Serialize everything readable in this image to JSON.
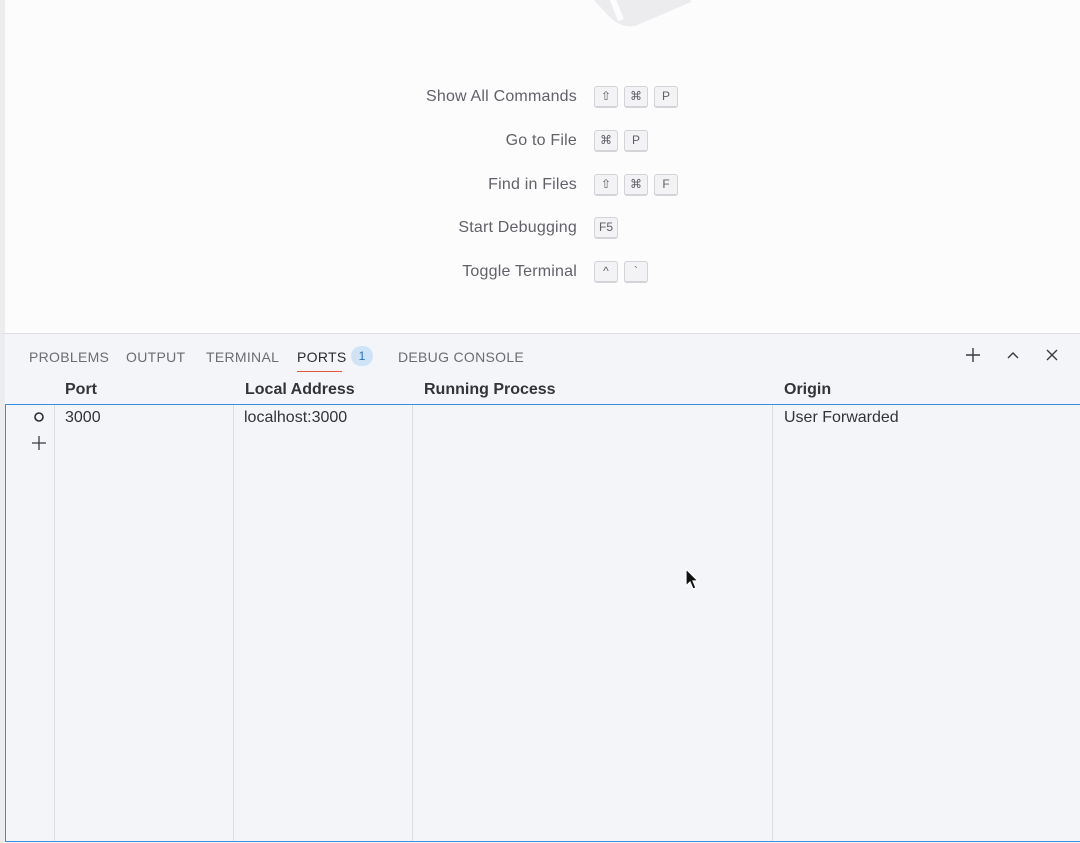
{
  "welcome": {
    "shortcuts": [
      {
        "label": "Show All Commands",
        "keys": [
          "⇧",
          "⌘",
          "P"
        ]
      },
      {
        "label": "Go to File",
        "keys": [
          "⌘",
          "P"
        ]
      },
      {
        "label": "Find in Files",
        "keys": [
          "⇧",
          "⌘",
          "F"
        ]
      },
      {
        "label": "Start Debugging",
        "keys": [
          "F5"
        ]
      },
      {
        "label": "Toggle Terminal",
        "keys": [
          "^",
          "`"
        ]
      }
    ]
  },
  "panel": {
    "tabs": [
      {
        "label": "PROBLEMS",
        "active": false
      },
      {
        "label": "OUTPUT",
        "active": false
      },
      {
        "label": "TERMINAL",
        "active": false
      },
      {
        "label": "PORTS",
        "active": true,
        "badge": "1"
      },
      {
        "label": "DEBUG CONSOLE",
        "active": false
      }
    ],
    "actions": [
      "add-icon",
      "chevron-up-icon",
      "close-icon"
    ],
    "accent_color": "#3b8edb",
    "active_tab_underline_color": "#e0573c"
  },
  "ports_table": {
    "columns": [
      "Port",
      "Local Address",
      "Running Process",
      "Origin"
    ],
    "rows": [
      {
        "port": "3000",
        "local_address": "localhost:3000",
        "running_process": "",
        "origin": "User Forwarded"
      }
    ]
  }
}
